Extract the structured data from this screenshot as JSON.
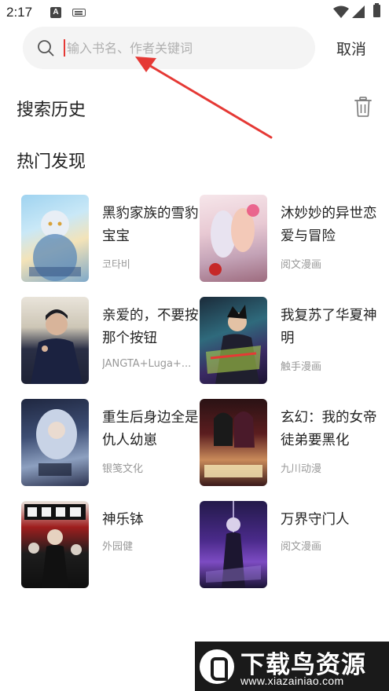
{
  "status_bar": {
    "time": "2:17",
    "notification_icons": [
      "a-icon",
      "keyboard-icon"
    ],
    "system_icons": [
      "wifi-icon",
      "signal-icon",
      "battery-icon"
    ]
  },
  "search": {
    "placeholder": "输入书名、作者关键词",
    "value": "",
    "cancel_label": "取消"
  },
  "history": {
    "title": "搜索历史"
  },
  "hot": {
    "title": "热门发现",
    "items": [
      {
        "title": "黑豹家族的雪豹宝宝",
        "author": "코타비"
      },
      {
        "title": "沐妙妙的异世恋爱与冒险",
        "author": "阅文漫画"
      },
      {
        "title": "亲爱的，不要按那个按钮",
        "author": "JANGTA+Luga+..."
      },
      {
        "title": "我复苏了华夏神明",
        "author": "触手漫画"
      },
      {
        "title": "重生后身边全是仇人幼崽",
        "author": "银笺文化"
      },
      {
        "title": "玄幻：我的女帝徒弟要黑化",
        "author": "九川动漫"
      },
      {
        "title": "神乐钵",
        "author": "外园健"
      },
      {
        "title": "万界守门人",
        "author": "阅文漫画"
      }
    ]
  },
  "watermark": {
    "name": "下载鸟资源",
    "url": "www.xiazainiao.com"
  },
  "colors": {
    "accent_red": "#e53935",
    "search_bg": "#f4f4f4",
    "muted_text": "#999999"
  }
}
